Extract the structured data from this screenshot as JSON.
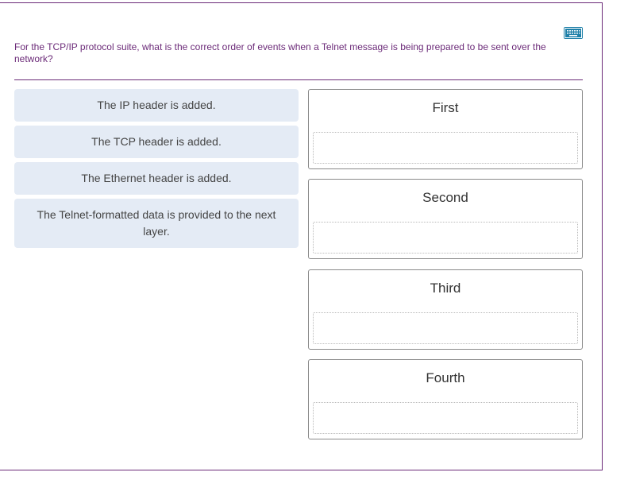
{
  "question": "For the TCP/IP protocol suite, what is the correct order of events when a Telnet message is being prepared to be sent over the network?",
  "options": [
    "The IP header is added.",
    "The TCP header is added.",
    "The Ethernet header is added.",
    "The Telnet-formatted data is provided to the next layer."
  ],
  "targets": [
    "First",
    "Second",
    "Third",
    "Fourth"
  ],
  "icons": {
    "keyboard": "keyboard-icon"
  },
  "colors": {
    "accent": "#6b2a78",
    "option_bg": "#e4ebf5",
    "keyboard_icon_bg": "#1d7fa8"
  }
}
